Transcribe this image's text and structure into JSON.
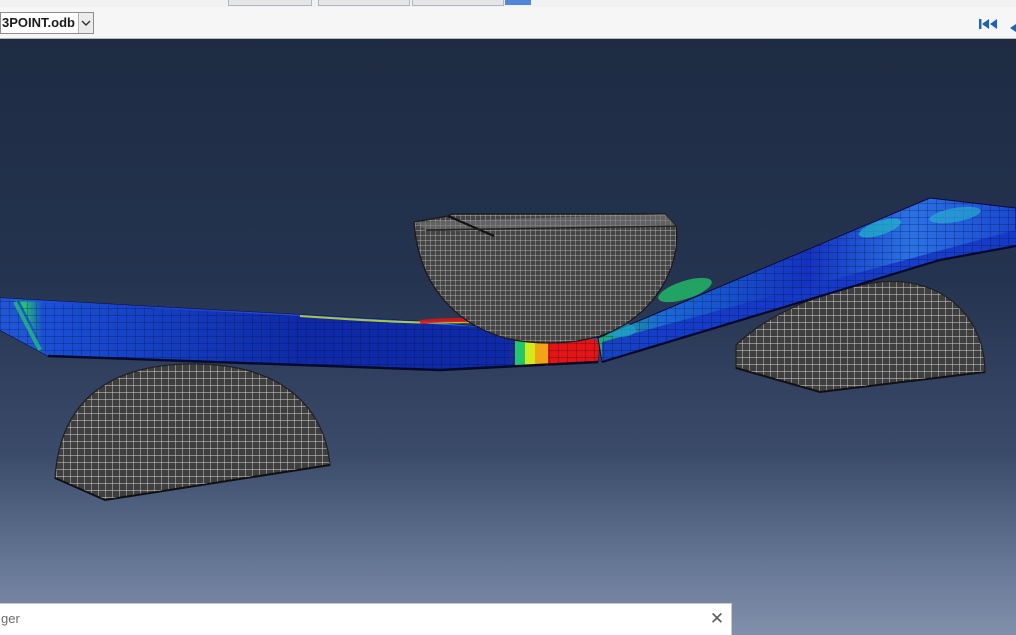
{
  "toolbar": {
    "odb_file": "3POINT.odb",
    "odb_dropdown_icon": "chevron-down-icon",
    "first_frame_icon": "skip-to-first-icon",
    "prev_frame_icon": "previous-frame-icon",
    "accent_color": "#1f5fbf"
  },
  "viewport": {
    "model_parts": [
      "punch",
      "left-support",
      "right-support",
      "beam-specimen"
    ],
    "contour_colors": [
      "#0a1aa8",
      "#1e5ee8",
      "#16b4e2",
      "#20c86a",
      "#d2ea1a",
      "#f2a414",
      "#e01414"
    ],
    "mesh_color": "#d8d8d8",
    "background_top": "#1e2b43",
    "background_bottom": "#8190aa"
  },
  "message_window": {
    "title": "ger",
    "close_icon": "close-icon"
  }
}
